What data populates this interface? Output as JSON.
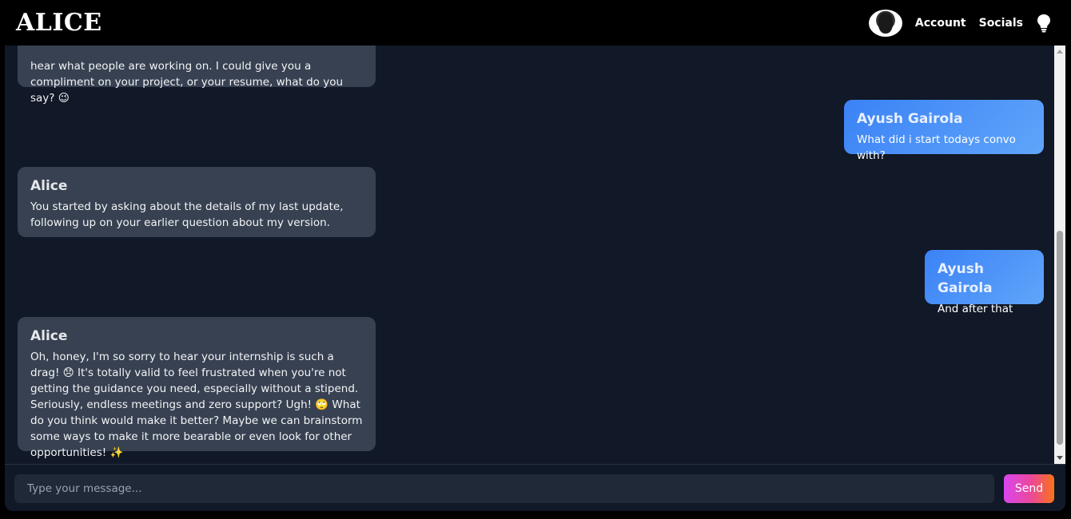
{
  "app": {
    "title": "ALICE"
  },
  "nav": {
    "account": "Account",
    "socials": "Socials"
  },
  "messages": [
    {
      "sender": "",
      "role": "bot",
      "text": "hear what people are working on. I could give you a compliment on your project, or your resume, what do you say? 😉"
    },
    {
      "sender": "Ayush Gairola",
      "role": "user",
      "text": "What did i start todays convo with?"
    },
    {
      "sender": "Alice",
      "role": "bot",
      "text": "You started by asking about the details of my last update, following up on your earlier question about my version."
    },
    {
      "sender": "Ayush Gairola",
      "role": "user",
      "text": "And after that"
    },
    {
      "sender": "Alice",
      "role": "bot",
      "text": "Oh, honey, I'm so sorry to hear your internship is such a drag! 😞 It's totally valid to feel frustrated when you're not getting the guidance you need, especially without a stipend. Seriously, endless meetings and zero support? Ugh! 🙄 What do you think would make it better? Maybe we can brainstorm some ways to make it more bearable or even look for other opportunities! ✨"
    }
  ],
  "composer": {
    "placeholder": "Type your message...",
    "send_label": "Send"
  },
  "colors": {
    "user_bubble": "#3b82f6",
    "bot_bubble": "#374151",
    "send_gradient_start": "#d946ef",
    "send_gradient_end": "#f97316"
  },
  "icons": {
    "avatar": "avatar",
    "theme": "lightbulb-icon"
  }
}
